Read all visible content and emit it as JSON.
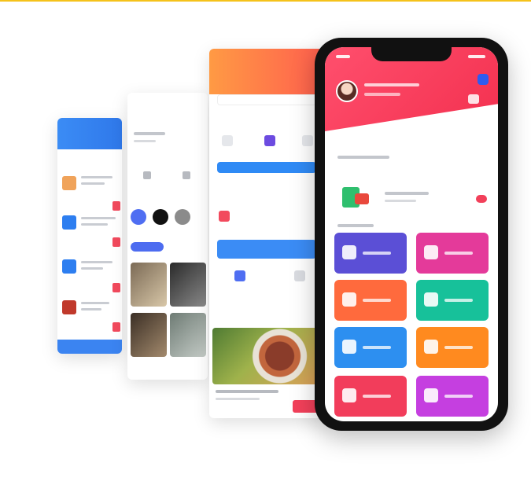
{
  "colors": {
    "accent_yellow": "#f5c21b",
    "brand_red": "#f3304f",
    "blue": "#3b84f1",
    "orange": "#ff7a45"
  },
  "phone": {
    "tiles": [
      {
        "icon": "profile-icon",
        "color": "#5b4fd6"
      },
      {
        "icon": "group-icon",
        "color": "#e43a9a"
      },
      {
        "icon": "food-icon",
        "color": "#ff6a3d"
      },
      {
        "icon": "tool-icon",
        "color": "#17c19a"
      },
      {
        "icon": "calendar-icon",
        "color": "#2d8ff0"
      },
      {
        "icon": "home-icon",
        "color": "#ff8a1f"
      },
      {
        "icon": "document-icon",
        "color": "#f23d5b"
      },
      {
        "icon": "gift-icon",
        "color": "#c53fe0"
      }
    ]
  }
}
